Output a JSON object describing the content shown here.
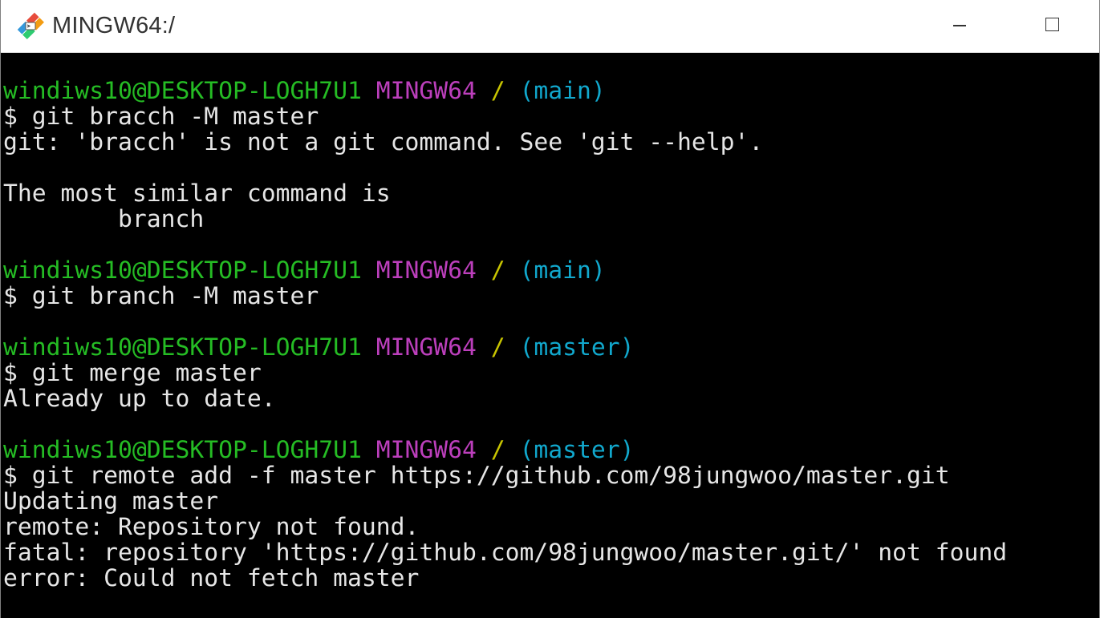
{
  "window": {
    "title": "MINGW64:/",
    "icon": "git-bash-icon"
  },
  "colors": {
    "user_host": "#25bc24",
    "shell": "#bc3fbc",
    "path": "#c7c400",
    "branch": "#11a8cd",
    "output": "#e6e6e6"
  },
  "terminal": {
    "blocks": [
      {
        "prompt": {
          "user_host": "windiws10@DESKTOP-LOGH7U1",
          "shell": "MINGW64",
          "path": "/",
          "branch": "(main)"
        },
        "command": "$ git bracch -M master",
        "output": [
          "git: 'bracch' is not a git command. See 'git --help'.",
          "",
          "The most similar command is",
          "        branch",
          ""
        ]
      },
      {
        "prompt": {
          "user_host": "windiws10@DESKTOP-LOGH7U1",
          "shell": "MINGW64",
          "path": "/",
          "branch": "(main)"
        },
        "command": "$ git branch -M master",
        "output": [
          ""
        ]
      },
      {
        "prompt": {
          "user_host": "windiws10@DESKTOP-LOGH7U1",
          "shell": "MINGW64",
          "path": "/",
          "branch": "(master)"
        },
        "command": "$ git merge master",
        "output": [
          "Already up to date.",
          ""
        ]
      },
      {
        "prompt": {
          "user_host": "windiws10@DESKTOP-LOGH7U1",
          "shell": "MINGW64",
          "path": "/",
          "branch": "(master)"
        },
        "command": "$ git remote add -f master https://github.com/98jungwoo/master.git",
        "output": [
          "Updating master",
          "remote: Repository not found.",
          "fatal: repository 'https://github.com/98jungwoo/master.git/' not found",
          "error: Could not fetch master"
        ]
      }
    ]
  }
}
